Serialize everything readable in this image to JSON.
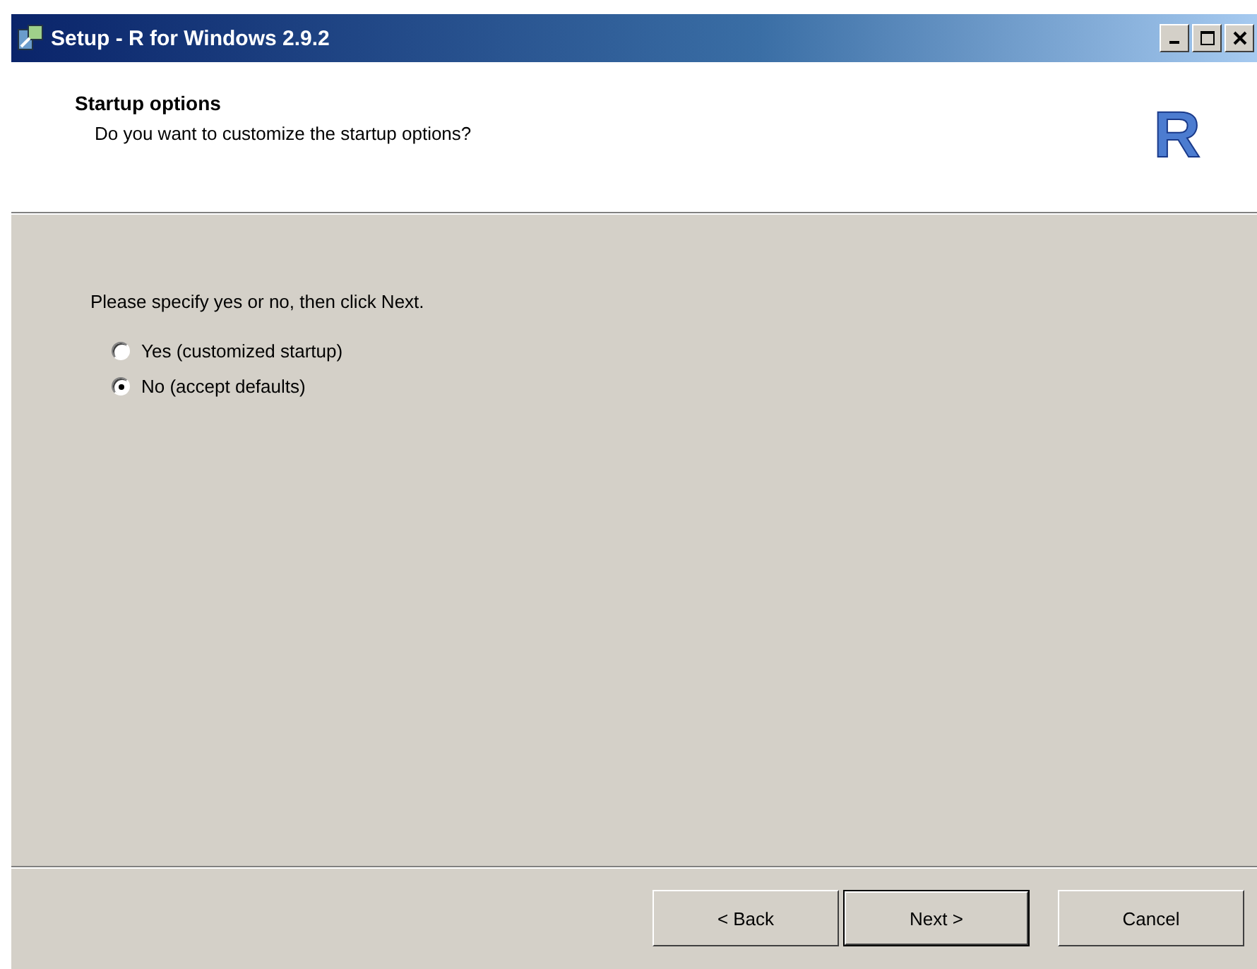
{
  "window": {
    "title": "Setup - R for Windows 2.9.2"
  },
  "header": {
    "title": "Startup options",
    "subtitle": "Do you want to customize the startup options?",
    "logo": "R"
  },
  "instruction": "Please specify yes or no, then click Next.",
  "options": [
    {
      "label": "Yes (customized startup)",
      "selected": false
    },
    {
      "label": "No (accept defaults)",
      "selected": true
    }
  ],
  "buttons": [
    {
      "label": "< Back",
      "default": false
    },
    {
      "label": "Next >",
      "default": true
    },
    {
      "label": "Cancel",
      "default": false
    }
  ]
}
